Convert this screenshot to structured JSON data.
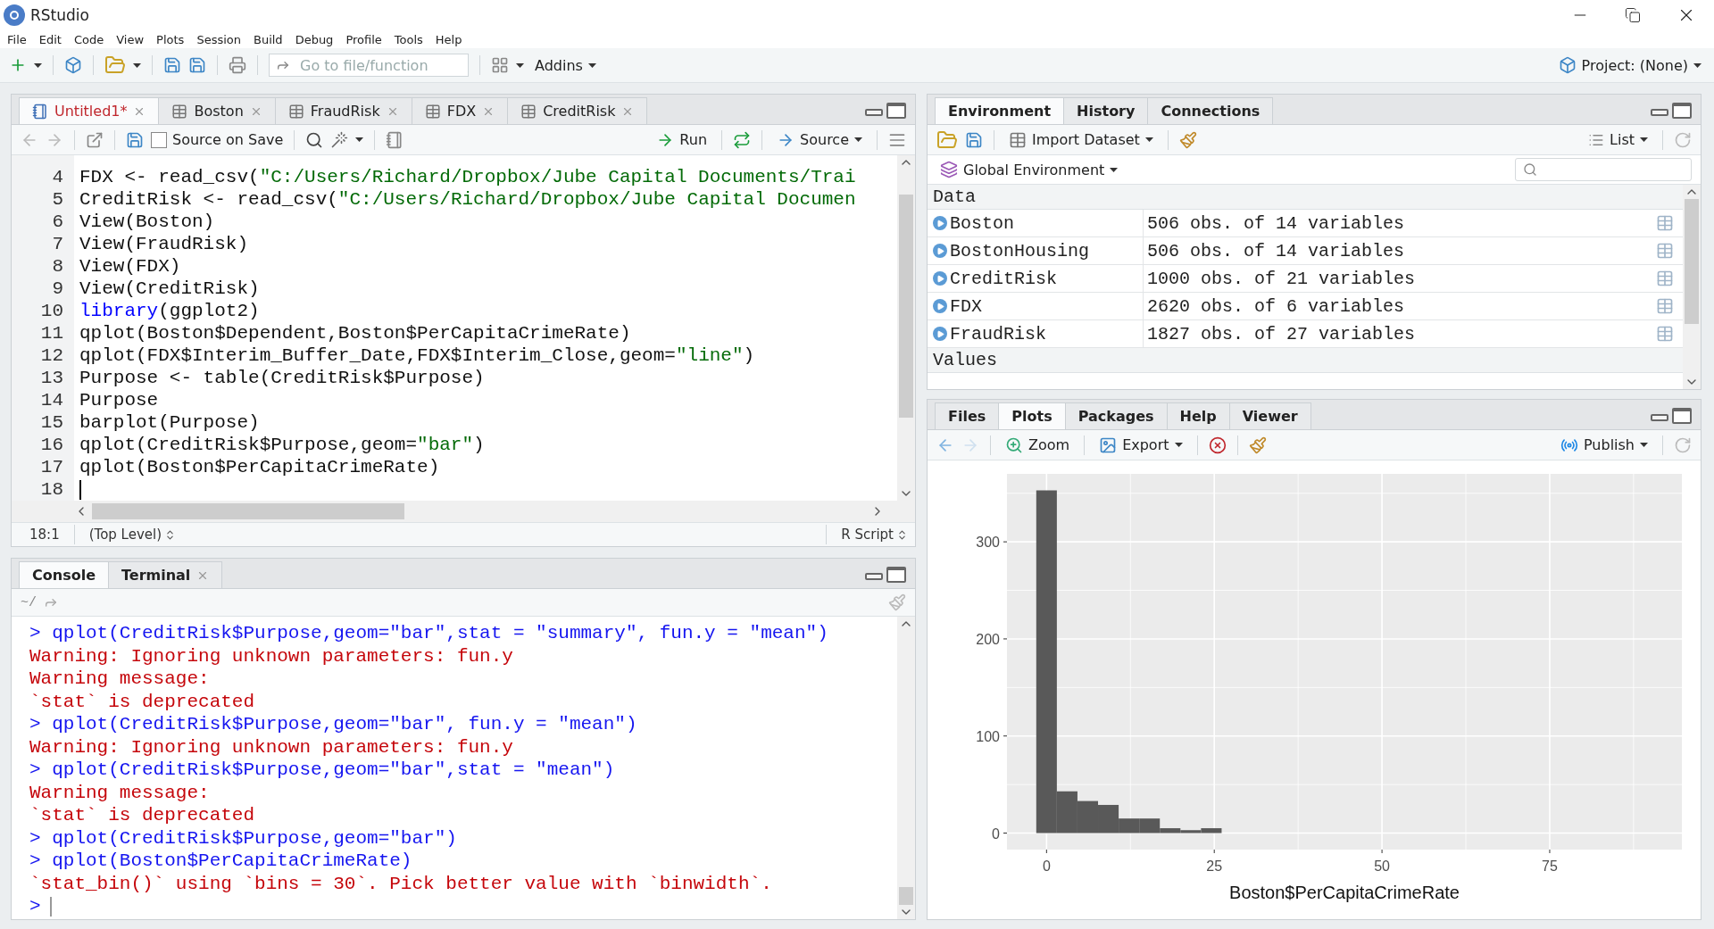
{
  "window": {
    "title": "RStudio"
  },
  "menu": [
    "File",
    "Edit",
    "Code",
    "View",
    "Plots",
    "Session",
    "Build",
    "Debug",
    "Profile",
    "Tools",
    "Help"
  ],
  "toolbar": {
    "goto_placeholder": "Go to file/function",
    "addins": "Addins",
    "project": "Project: (None)"
  },
  "editor": {
    "tabs": [
      {
        "label": "Untitled1*",
        "kind": "script",
        "selected": true,
        "modified": true
      },
      {
        "label": "Boston",
        "kind": "data",
        "selected": false,
        "modified": false
      },
      {
        "label": "FraudRisk",
        "kind": "data",
        "selected": false,
        "modified": false
      },
      {
        "label": "FDX",
        "kind": "data",
        "selected": false,
        "modified": false
      },
      {
        "label": "CreditRisk",
        "kind": "data",
        "selected": false,
        "modified": false
      }
    ],
    "source_on_save": {
      "label": "Source on Save",
      "checked": false
    },
    "run": "Run",
    "source": "Source",
    "lines": [
      {
        "number": "4",
        "cursor": false,
        "tokens": [
          {
            "kind": "plain",
            "text": "FDX <- read_csv("
          },
          {
            "kind": "string",
            "text": "\"C:/Users/Richard/Dropbox/Jube Capital Documents/Trai"
          }
        ]
      },
      {
        "number": "5",
        "cursor": false,
        "tokens": [
          {
            "kind": "plain",
            "text": "CreditRisk <- read_csv("
          },
          {
            "kind": "string",
            "text": "\"C:/Users/Richard/Dropbox/Jube Capital Documen"
          }
        ]
      },
      {
        "number": "6",
        "cursor": false,
        "tokens": [
          {
            "kind": "plain",
            "text": "View(Boston)"
          }
        ]
      },
      {
        "number": "7",
        "cursor": false,
        "tokens": [
          {
            "kind": "plain",
            "text": "View(FraudRisk)"
          }
        ]
      },
      {
        "number": "8",
        "cursor": false,
        "tokens": [
          {
            "kind": "plain",
            "text": "View(FDX)"
          }
        ]
      },
      {
        "number": "9",
        "cursor": false,
        "tokens": [
          {
            "kind": "plain",
            "text": "View(CreditRisk)"
          }
        ]
      },
      {
        "number": "10",
        "cursor": false,
        "tokens": [
          {
            "kind": "keyword",
            "text": "library"
          },
          {
            "kind": "plain",
            "text": "(ggplot2)"
          }
        ]
      },
      {
        "number": "11",
        "cursor": false,
        "tokens": [
          {
            "kind": "plain",
            "text": "qplot(Boston$Dependent,Boston$PerCapitaCrimeRate)"
          }
        ]
      },
      {
        "number": "12",
        "cursor": false,
        "tokens": [
          {
            "kind": "plain",
            "text": "qplot(FDX$Interim_Buffer_Date,FDX$Interim_Close,geom="
          },
          {
            "kind": "string",
            "text": "\"line\""
          },
          {
            "kind": "plain",
            "text": ")"
          }
        ]
      },
      {
        "number": "13",
        "cursor": false,
        "tokens": [
          {
            "kind": "plain",
            "text": "Purpose <- table(CreditRisk$Purpose)"
          }
        ]
      },
      {
        "number": "14",
        "cursor": false,
        "tokens": [
          {
            "kind": "plain",
            "text": "Purpose"
          }
        ]
      },
      {
        "number": "15",
        "cursor": false,
        "tokens": [
          {
            "kind": "plain",
            "text": "barplot(Purpose)"
          }
        ]
      },
      {
        "number": "16",
        "cursor": false,
        "tokens": [
          {
            "kind": "plain",
            "text": "qplot(CreditRisk$Purpose,geom="
          },
          {
            "kind": "string",
            "text": "\"bar\""
          },
          {
            "kind": "plain",
            "text": ")"
          }
        ]
      },
      {
        "number": "17",
        "cursor": false,
        "tokens": [
          {
            "kind": "plain",
            "text": "qplot(Boston$PerCapitaCrimeRate)"
          }
        ]
      },
      {
        "number": "18",
        "cursor": true
      }
    ],
    "status": {
      "position": "18:1",
      "scope": "(Top Level)",
      "file_type": "R Script"
    }
  },
  "console": {
    "tabs": [
      {
        "label": "Console",
        "selected": true,
        "closable": false
      },
      {
        "label": "Terminal",
        "selected": false,
        "closable": true
      }
    ],
    "path": "~/",
    "lines": [
      {
        "kind": "input",
        "text": "> qplot(CreditRisk$Purpose,geom=\"bar\",stat = \"summary\", fun.y = \"mean\")"
      },
      {
        "kind": "output",
        "text": "Warning: Ignoring unknown parameters: fun.y"
      },
      {
        "kind": "output",
        "text": "Warning message:"
      },
      {
        "kind": "output",
        "text": "`stat` is deprecated"
      },
      {
        "kind": "input",
        "text": "> qplot(CreditRisk$Purpose,geom=\"bar\", fun.y = \"mean\")"
      },
      {
        "kind": "output",
        "text": "Warning: Ignoring unknown parameters: fun.y"
      },
      {
        "kind": "input",
        "text": "> qplot(CreditRisk$Purpose,geom=\"bar\",stat = \"mean\")"
      },
      {
        "kind": "output",
        "text": "Warning message:"
      },
      {
        "kind": "output",
        "text": "`stat` is deprecated"
      },
      {
        "kind": "input",
        "text": "> qplot(CreditRisk$Purpose,geom=\"bar\")"
      },
      {
        "kind": "input",
        "text": "> qplot(Boston$PerCapitaCrimeRate)"
      },
      {
        "kind": "output",
        "text": "`stat_bin()` using `bins = 30`. Pick better value with `binwidth`."
      }
    ],
    "prompt": ">"
  },
  "environment": {
    "tabs": [
      {
        "label": "Environment",
        "selected": true
      },
      {
        "label": "History",
        "selected": false
      },
      {
        "label": "Connections",
        "selected": false
      }
    ],
    "import": "Import Dataset",
    "view_mode": "List",
    "scope": "Global Environment",
    "data_heading": "Data",
    "rows": [
      {
        "name": "Boston",
        "value": "506 obs. of 14 variables"
      },
      {
        "name": "BostonHousing",
        "value": "506 obs. of 14 variables"
      },
      {
        "name": "CreditRisk",
        "value": "1000 obs. of 21 variables"
      },
      {
        "name": "FDX",
        "value": "2620 obs. of 6 variables"
      },
      {
        "name": "FraudRisk",
        "value": "1827 obs. of 27 variables"
      }
    ],
    "values_heading": "Values"
  },
  "files": {
    "tabs": [
      {
        "label": "Files",
        "selected": false
      },
      {
        "label": "Plots",
        "selected": true
      },
      {
        "label": "Packages",
        "selected": false
      },
      {
        "label": "Help",
        "selected": false
      },
      {
        "label": "Viewer",
        "selected": false
      }
    ],
    "zoom": "Zoom",
    "export": "Export",
    "publish": "Publish",
    "chart_data": {
      "type": "bar",
      "xlabel": "Boston$PerCapitaCrimeRate",
      "x": [
        0,
        3.07,
        6.14,
        9.21,
        12.28,
        15.35,
        18.42,
        21.49,
        24.56
      ],
      "values": [
        353,
        43,
        33,
        29,
        15,
        15,
        5,
        3,
        5
      ],
      "grid": true,
      "xlim": [
        -5.9,
        94.7
      ],
      "ylim": [
        -17,
        370
      ],
      "xticks": [
        0,
        25,
        50,
        75
      ],
      "yticks": [
        0,
        100,
        200,
        300
      ]
    }
  }
}
